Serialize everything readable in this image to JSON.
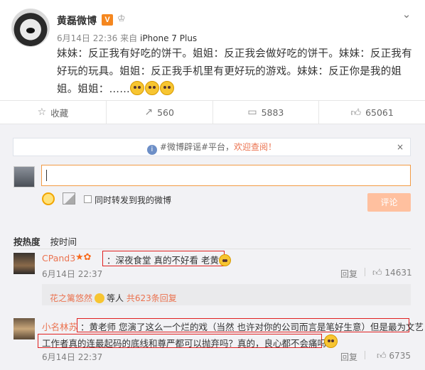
{
  "post": {
    "username": "黄磊微博",
    "vip_badge": "V",
    "time": "6月14日 22:36",
    "source_prefix": "来自",
    "source": "iPhone 7 Plus",
    "content": "妹妹：反正我有好吃的饼干。姐姐：反正我会做好吃的饼干。妹妹：反正我有好玩的玩具。姐姐：反正我手机里有更好玩的游戏。妹妹：反正你是我的姐姐。姐姐：……"
  },
  "actions": {
    "favorite": "收藏",
    "forward_count": "560",
    "comment_count": "5883",
    "like_count": "65061"
  },
  "notice": {
    "tag": "#微博辟谣#平台，",
    "link": "欢迎查阅！",
    "close": "×"
  },
  "composer": {
    "forward_label": "同时转发到我的微博",
    "submit_label": "评论"
  },
  "sort": {
    "by_hot": "按热度",
    "by_time": "按时间"
  },
  "comments": [
    {
      "name": "CPand3",
      "text": "：深夜食堂 真的不好看 老黄",
      "time": "6月14日 22:37",
      "reply": "回复",
      "likes": "14631",
      "sub": {
        "user": "花之篱悠然",
        "others": "等人",
        "count_text": "共623条回复"
      }
    },
    {
      "name": "小名林苏",
      "text_line1": "：黄老师 您演了这么一个烂的戏（当然 也许对你的公司而言是笔好生意）但是最为文艺",
      "text_line2": "工作者真的连最起码的底线和尊严都可以抛弃吗？真的，良心都不会痛吗？",
      "time": "6月14日 22:37",
      "reply": "回复",
      "likes": "6735"
    }
  ]
}
